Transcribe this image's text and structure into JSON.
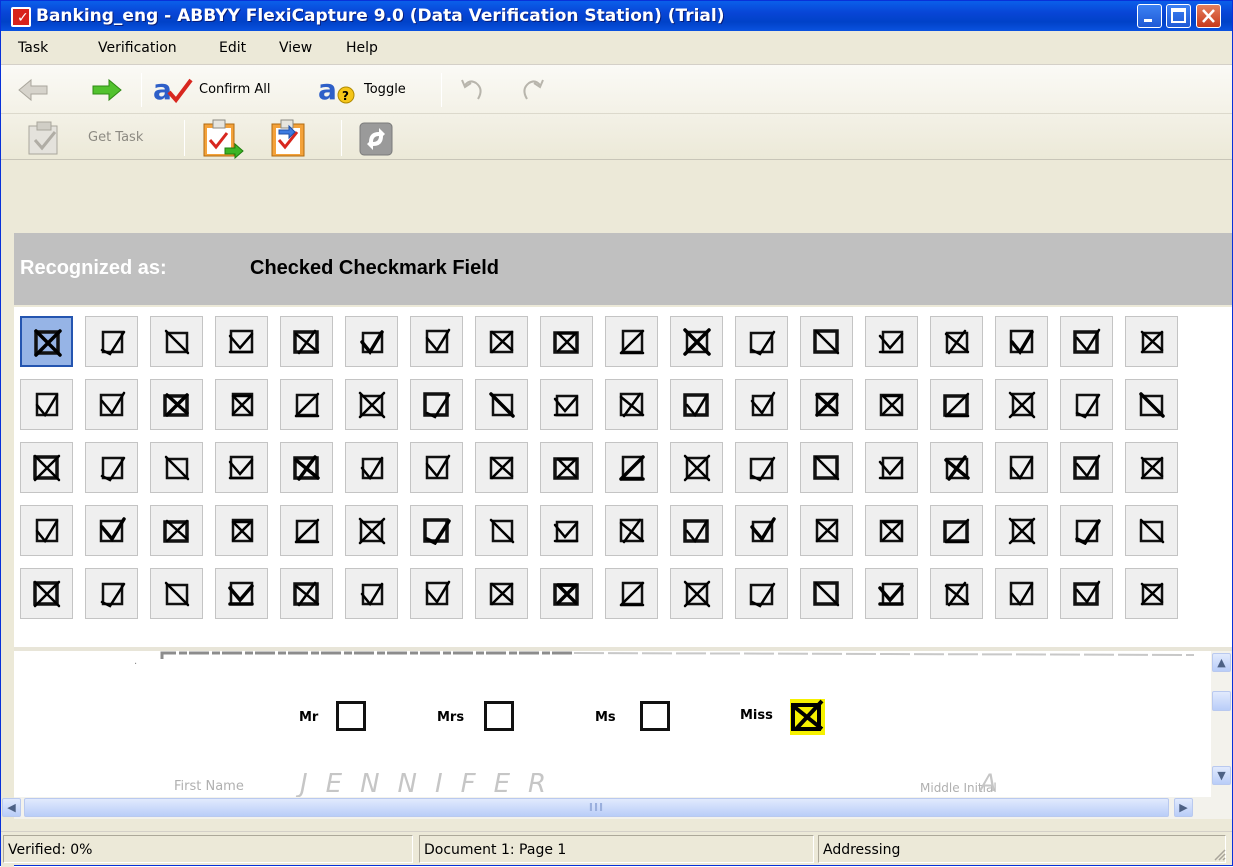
{
  "window": {
    "title": "Banking_eng - ABBYY FlexiCapture 9.0 (Data Verification Station) (Trial)"
  },
  "menu": [
    "Task",
    "Verification",
    "Edit",
    "View",
    "Help"
  ],
  "toolbar1": {
    "confirm_all": "Confirm All",
    "toggle": "Toggle"
  },
  "toolbar2": {
    "get_task": "Get Task"
  },
  "recognized": {
    "label": "Recognized as:",
    "value": "Checked Checkmark Field"
  },
  "grid": {
    "rows": 5,
    "cols": 18,
    "selected_index": 0
  },
  "document": {
    "checkbox_labels": [
      "Mr",
      "Mrs",
      "Ms",
      "Miss"
    ],
    "checked_label": "Miss",
    "first_name_label": "First Name",
    "first_name_value": "JENNIFER",
    "middle_initial_label": "Middle Initial",
    "middle_initial_value": "A"
  },
  "status": {
    "verified": "Verified: 0%",
    "document": "Document 1: Page 1",
    "section": "Addressing"
  }
}
